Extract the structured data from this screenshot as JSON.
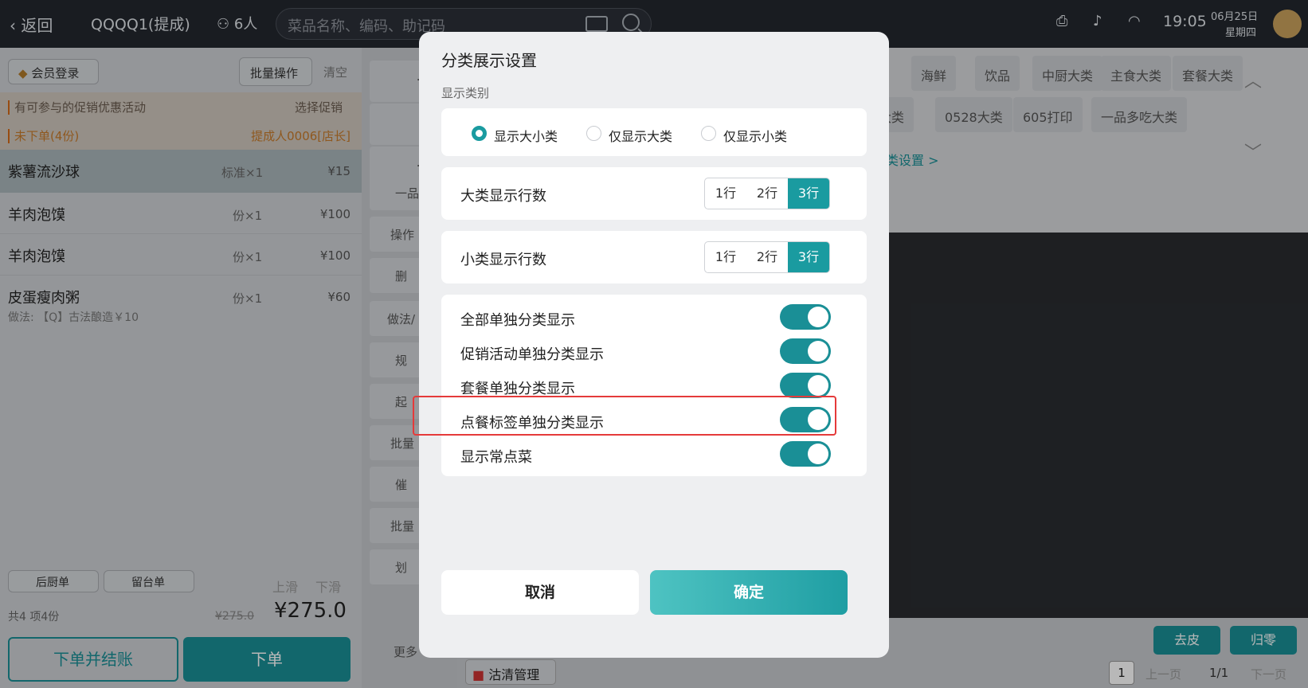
{
  "topbar": {
    "back": "返回",
    "table": "QQQQ1(提成)",
    "guests": "6人",
    "search_placeholder": "菜品名称、编码、助记码",
    "time": "19:05",
    "date": "06月25日",
    "weekday": "星期四"
  },
  "left": {
    "member": "会员登录",
    "batch": "批量操作",
    "clear": "清空",
    "promo": "有可参与的促销优惠活动",
    "promo_action": "选择促销",
    "unordered": "未下单(4份)",
    "submitter": "提成人0006[店长]",
    "items": [
      {
        "name": "紫薯流沙球",
        "spec": "标准×1",
        "price": "¥15"
      },
      {
        "name": "羊肉泡馍",
        "spec": "份×1",
        "price": "¥100"
      },
      {
        "name": "羊肉泡馍",
        "spec": "份×1",
        "price": "¥100"
      },
      {
        "name": "皮蛋瘦肉粥",
        "spec": "份×1",
        "price": "¥60",
        "note": "做法:  【Q】古法酿造￥10"
      }
    ],
    "kitchen": "后厨单",
    "hold": "留台单",
    "scroll_up": "上滑",
    "scroll_down": "下滑",
    "summary": "共4 项4份",
    "orig_total": "¥275.0",
    "total": "¥275.0",
    "checkout": "下单并结账",
    "order": "下单"
  },
  "mid": {
    "items": [
      "一品",
      "操作",
      "删",
      "做法/",
      "规",
      "起",
      "批量",
      "催",
      "批量",
      "划"
    ],
    "more": "更多"
  },
  "right": {
    "cats1": [
      "海鲜",
      "饮品",
      "中厨大类",
      "主食大类",
      "套餐大类"
    ],
    "cats2": [
      "部A大类",
      "0528大类",
      "605打印",
      "一品多吃大类"
    ],
    "setting_link": "类设置 >",
    "peel": "去皮",
    "round": "归零",
    "clean": "沽清管理",
    "page_num": "1",
    "prev": "上一页",
    "pages": "1/1",
    "next": "下一页"
  },
  "dialog": {
    "title": "分类展示设置",
    "section": "显示类别",
    "radios": [
      {
        "label": "显示大小类",
        "checked": true
      },
      {
        "label": "仅显示大类",
        "checked": false
      },
      {
        "label": "仅显示小类",
        "checked": false
      }
    ],
    "big_rows_label": "大类显示行数",
    "small_rows_label": "小类显示行数",
    "row_options": [
      "1行",
      "2行",
      "3行"
    ],
    "big_rows_selected": "3行",
    "small_rows_selected": "3行",
    "toggles": [
      {
        "label": "全部单独分类显示",
        "on": true
      },
      {
        "label": "促销活动单独分类显示",
        "on": true
      },
      {
        "label": "套餐单独分类显示",
        "on": true
      },
      {
        "label": "点餐标签单独分类显示",
        "on": true
      },
      {
        "label": "显示常点菜",
        "on": true
      }
    ],
    "cancel": "取消",
    "confirm": "确定"
  },
  "colors": {
    "accent": "#1a9ba0",
    "highlight": "#e53a3a"
  }
}
